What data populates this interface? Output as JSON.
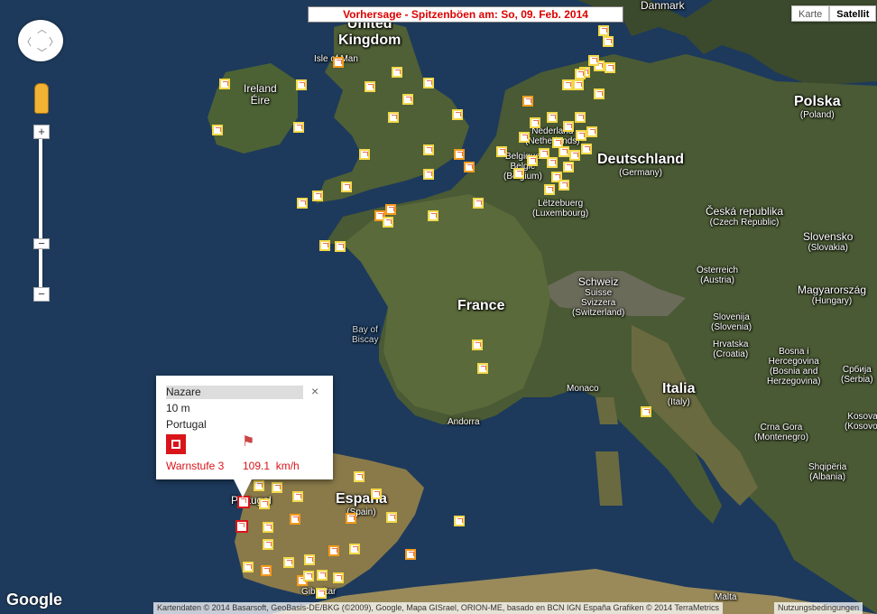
{
  "header": {
    "title": "Vorhersage - Spitzenböen am: So, 09. Feb. 2014"
  },
  "map_type": {
    "map_label": "Karte",
    "satellite_label": "Satellit",
    "selected": "Satellit"
  },
  "controls": {
    "zoom_in": "+",
    "zoom_out": "−",
    "zoom_mid": "−"
  },
  "labels": {
    "united_kingdom": "United\nKingdom",
    "isle_of_man": "Isle of Man",
    "ireland": "Ireland\nÉire",
    "danmark": "Danmark",
    "polska": "Polska",
    "polska_sub": "(Poland)",
    "nederland": "Nederland",
    "nederland_sub": "(Netherlands)",
    "belgique": "Belgique",
    "belgie": "België",
    "belgium": "(Belgium)",
    "luxembourg": "Lëtzebuerg",
    "luxembourg_sub": "(Luxembourg)",
    "deutschland": "Deutschland",
    "deutschland_sub": "(Germany)",
    "czech": "Česká republika",
    "czech_sub": "(Czech Republic)",
    "slovensko": "Slovensko",
    "slovensko_sub": "(Slovakia)",
    "osterreich": "Österreich",
    "osterreich_sub": "(Austria)",
    "magyarorszag": "Magyarország",
    "magyarorszag_sub": "(Hungary)",
    "schweiz1": "Schweiz",
    "schweiz2": "Suisse",
    "schweiz3": "Svizzera",
    "schweiz_sub": "(Switzerland)",
    "slovenija": "Slovenija",
    "slovenija_sub": "(Slovenia)",
    "hrvatska": "Hrvatska",
    "hrvatska_sub": "(Croatia)",
    "bosna": "Bosna i\nHercegovina",
    "bosna_sub": "(Bosnia and\nHerzegovina)",
    "srbija": "Србија",
    "srbija_sub": "(Serbia)",
    "france": "France",
    "bay_of_biscay": "Bay of\nBiscay",
    "monaco": "Monaco",
    "andorra": "Andorra",
    "italia": "Italia",
    "italia_sub": "(Italy)",
    "crna_gora": "Crna Gora",
    "crna_gora_sub": "(Montenegro)",
    "kosovo": "Kosova",
    "kosovo_sub": "(Kosovo)",
    "shqiperia": "Shqipëria",
    "shqiperia_sub": "(Albania)",
    "espana": "España",
    "espana_sub": "(Spain)",
    "portugal": "Portugal",
    "gibraltar": "Gibraltar",
    "malta": "Malta"
  },
  "popup": {
    "name": "Nazare",
    "height": "10 m",
    "country": "Portugal",
    "warn_level": "Warnstufe 3",
    "speed": "109.1",
    "speed_unit": "km/h",
    "close": "×"
  },
  "footer": {
    "google": "Google",
    "attribution": "Kartendaten © 2014 Basarsoft, GeoBasis-DE/BKG (©2009), Google, Mapa GISrael, ORION-ME, basado en BCN IGN España Grafiken © 2014 TerraMetrics",
    "terms": "Nutzungsbedingungen"
  },
  "colors": {
    "alert_red": "#d9141a",
    "marker_yellow": "#f2d84a",
    "marker_orange": "#f39a1d"
  }
}
